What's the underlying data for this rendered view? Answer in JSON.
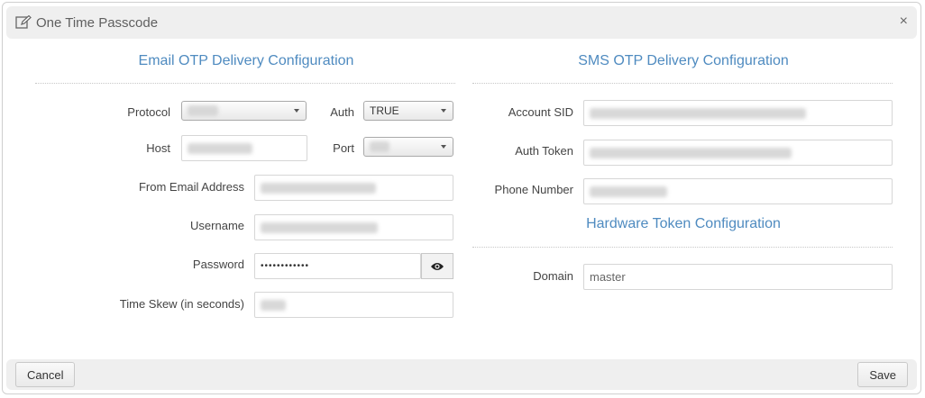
{
  "dialog": {
    "title": "One Time Passcode",
    "close_glyph": "×",
    "edit_icon": "edit-icon"
  },
  "email": {
    "section_title": "Email OTP Delivery Configuration",
    "protocol_label": "Protocol",
    "auth_label": "Auth",
    "auth_value": "TRUE",
    "host_label": "Host",
    "port_label": "Port",
    "from_label": "From Email Address",
    "username_label": "Username",
    "password_label": "Password",
    "password_value": "••••••••••••",
    "time_skew_label": "Time Skew (in seconds)"
  },
  "sms": {
    "section_title": "SMS OTP Delivery Configuration",
    "account_sid_label": "Account SID",
    "auth_token_label": "Auth Token",
    "phone_label": "Phone Number"
  },
  "hardware": {
    "section_title": "Hardware Token Configuration",
    "domain_label": "Domain",
    "domain_value": "master"
  },
  "footer": {
    "cancel_label": "Cancel",
    "save_label": "Save"
  },
  "colors": {
    "accent": "#4f8bc0",
    "header_bg": "#efefef"
  }
}
